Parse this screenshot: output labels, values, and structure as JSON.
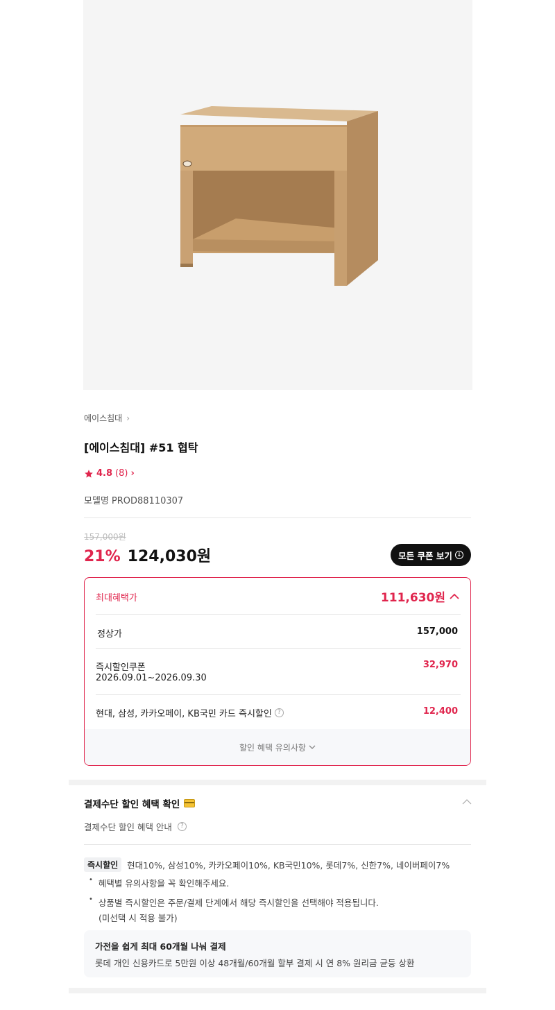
{
  "product": {
    "brand": "에이스침대",
    "title": "[에이스침대] #51 협탁",
    "rating": "4.8",
    "review_count": "(8)",
    "model_label": "모델명",
    "model_value": "PROD88110307"
  },
  "pricing": {
    "original": "157,000원",
    "discount_rate": "21%",
    "sale_price": "124,030원",
    "coupon_button": "모든 쿠폰 보기"
  },
  "benefit": {
    "max_label": "최대혜택가",
    "max_value": "111,630원",
    "regular_label": "정상가",
    "regular_value": "157,000",
    "coupon_label": "즉시할인쿠폰",
    "coupon_period": "2026.09.01~2026.09.30",
    "coupon_value": "32,970",
    "card_label": "현대, 삼성, 카카오페이, KB국민 카드 즉시할인",
    "card_value": "12,400",
    "notes_link": "할인 혜택 유의사항"
  },
  "payment": {
    "title": "결제수단 할인 혜택 확인",
    "subtitle": "결제수단 할인 혜택 안내",
    "instant_tag": "즉시할인",
    "instant_text": "현대10%, 삼성10%, 카카오페이10%, KB국민10%, 롯데7%, 신한7%, 네이버페이7%",
    "note1": "혜택별 유의사항을 꼭 확인해주세요.",
    "note2": "상품별 즉시할인은 주문/결제 단계에서 해당 즉시할인을 선택해야 적용됩니다.",
    "note2_cont": "(미선택 시 적용 불가)",
    "promo_title": "가전을 쉽게 최대 60개월 나눠 결제",
    "promo_desc": "롯데 개인 신용카드로 5만원 이상 48개월/60개월 할부 결제 시 연 8% 원리금 균등 상환"
  },
  "icons": [
    "star-icon",
    "chevron-right-icon",
    "download-icon",
    "chevron-up-icon",
    "chevron-down-icon",
    "help-icon",
    "card-icon"
  ],
  "colors": {
    "accent": "#e0254d",
    "dark": "#111111",
    "image_bg": "#f5f5f5"
  }
}
